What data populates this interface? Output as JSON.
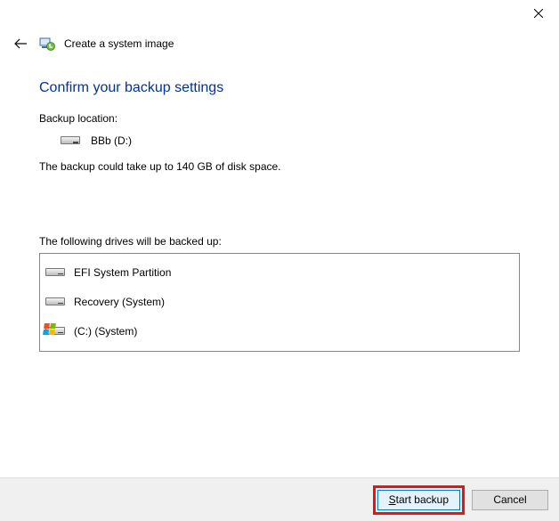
{
  "window": {
    "title": "Create a system image"
  },
  "heading": "Confirm your backup settings",
  "backup_location_label": "Backup location:",
  "backup_location_value": "BBb (D:)",
  "space_text": "The backup could take up to 140 GB of disk space.",
  "drives_label": "The following drives will be backed up:",
  "drives": [
    {
      "name": "EFI System Partition",
      "icon": "drive"
    },
    {
      "name": "Recovery (System)",
      "icon": "drive"
    },
    {
      "name": "(C:) (System)",
      "icon": "windows-drive"
    }
  ],
  "buttons": {
    "start": "Start backup",
    "cancel": "Cancel"
  }
}
